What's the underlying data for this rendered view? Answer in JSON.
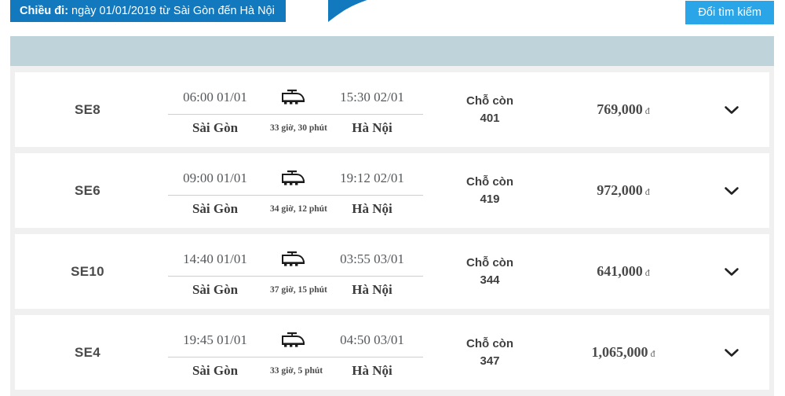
{
  "header": {
    "banner_prefix": "Chiều đi:",
    "banner_text": " ngày 01/01/2019 từ Sài Gòn đến Hà Nội",
    "search_button_label": "Đổi tìm kiếm",
    "banner_color": "#1279bf",
    "button_color": "#29a5e8",
    "table_header_color": "#bfd3da"
  },
  "results": [
    {
      "code": "SE8",
      "depart_time": "06:00 01/01",
      "depart_station": "Sài Gòn",
      "arrive_time": "15:30 02/01",
      "arrive_station": "Hà Nội",
      "duration": "33 giờ, 30 phút",
      "seats_label": "Chỗ còn",
      "seats_count": "401",
      "price": "769,000",
      "currency": "đ"
    },
    {
      "code": "SE6",
      "depart_time": "09:00 01/01",
      "depart_station": "Sài Gòn",
      "arrive_time": "19:12 02/01",
      "arrive_station": "Hà Nội",
      "duration": "34 giờ, 12 phút",
      "seats_label": "Chỗ còn",
      "seats_count": "419",
      "price": "972,000",
      "currency": "đ"
    },
    {
      "code": "SE10",
      "depart_time": "14:40 01/01",
      "depart_station": "Sài Gòn",
      "arrive_time": "03:55 03/01",
      "arrive_station": "Hà Nội",
      "duration": "37 giờ, 15 phút",
      "seats_label": "Chỗ còn",
      "seats_count": "344",
      "price": "641,000",
      "currency": "đ"
    },
    {
      "code": "SE4",
      "depart_time": "19:45 01/01",
      "depart_station": "Sài Gòn",
      "arrive_time": "04:50 03/01",
      "arrive_station": "Hà Nội",
      "duration": "33 giờ, 5 phút",
      "seats_label": "Chỗ còn",
      "seats_count": "347",
      "price": "1,065,000",
      "currency": "đ"
    }
  ],
  "icons": {
    "train": "train-icon",
    "expand": "chevron-down-icon"
  }
}
